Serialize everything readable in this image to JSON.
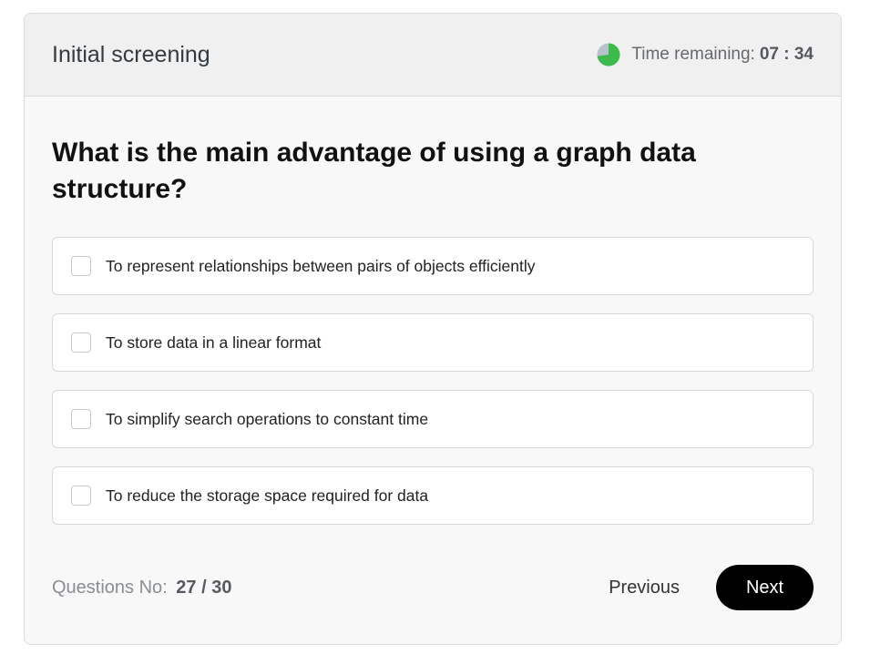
{
  "header": {
    "title": "Initial screening",
    "timer_label": "Time remaining:",
    "timer_value": "07 : 34",
    "timer_icon": "pie-clock-icon"
  },
  "question": {
    "text": "What is the main advantage of using a graph data structure?"
  },
  "options": [
    {
      "label": "To represent relationships between pairs of objects efficiently",
      "checked": false
    },
    {
      "label": "To store data in a linear format",
      "checked": false
    },
    {
      "label": "To simplify search operations to constant time",
      "checked": false
    },
    {
      "label": "To reduce the storage space required for data",
      "checked": false
    }
  ],
  "footer": {
    "questions_label": "Questions No:",
    "questions_value": "27 / 30",
    "previous_label": "Previous",
    "next_label": "Next"
  },
  "colors": {
    "accent": "#000000",
    "timer_green": "#3dba4e",
    "timer_gray": "#b9c2cc"
  }
}
